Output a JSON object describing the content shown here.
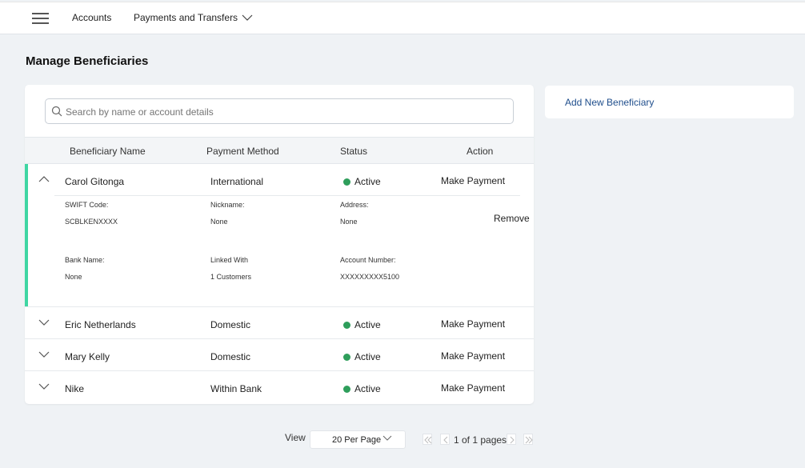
{
  "nav": {
    "menu_icon": "hamburger-icon",
    "accounts": "Accounts",
    "payments": "Payments and Transfers"
  },
  "page": {
    "title": "Manage Beneficiaries"
  },
  "search": {
    "placeholder": "Search by name or account details"
  },
  "table": {
    "headers": [
      "Beneficiary Name",
      "Payment Method",
      "Status",
      "Action"
    ],
    "rows": [
      {
        "name": "Carol Gitonga",
        "method": "International",
        "status": "Active",
        "action": "Make Payment",
        "expanded": true
      },
      {
        "name": "Eric Netherlands",
        "method": "Domestic",
        "status": "Active",
        "action": "Make Payment",
        "expanded": false
      },
      {
        "name": "Mary Kelly",
        "method": "Domestic",
        "status": "Active",
        "action": "Make Payment",
        "expanded": false
      },
      {
        "name": "Nike",
        "method": "Within Bank",
        "status": "Active",
        "action": "Make Payment",
        "expanded": false
      }
    ],
    "details": {
      "swift_label": "SWIFT Code:",
      "swift_value": "SCBLKENXXXX",
      "nickname_label": "Nickname:",
      "nickname_value": "None",
      "address_label": "Address:",
      "address_value": "None",
      "bank_label": "Bank Name:",
      "bank_value": "None",
      "linked_label": "Linked With",
      "linked_value": "1 Customers",
      "account_label": "Account Number:",
      "account_value": "XXXXXXXXX5100",
      "remove": "Remove"
    }
  },
  "side": {
    "add": "Add New Beneficiary"
  },
  "pagination": {
    "view_label": "View",
    "per_page": "20 Per Page",
    "pages": "1 of 1 pages"
  },
  "colors": {
    "accent": "#3fd6a3",
    "link": "#1f4e8c",
    "active": "#2e9e5b"
  }
}
